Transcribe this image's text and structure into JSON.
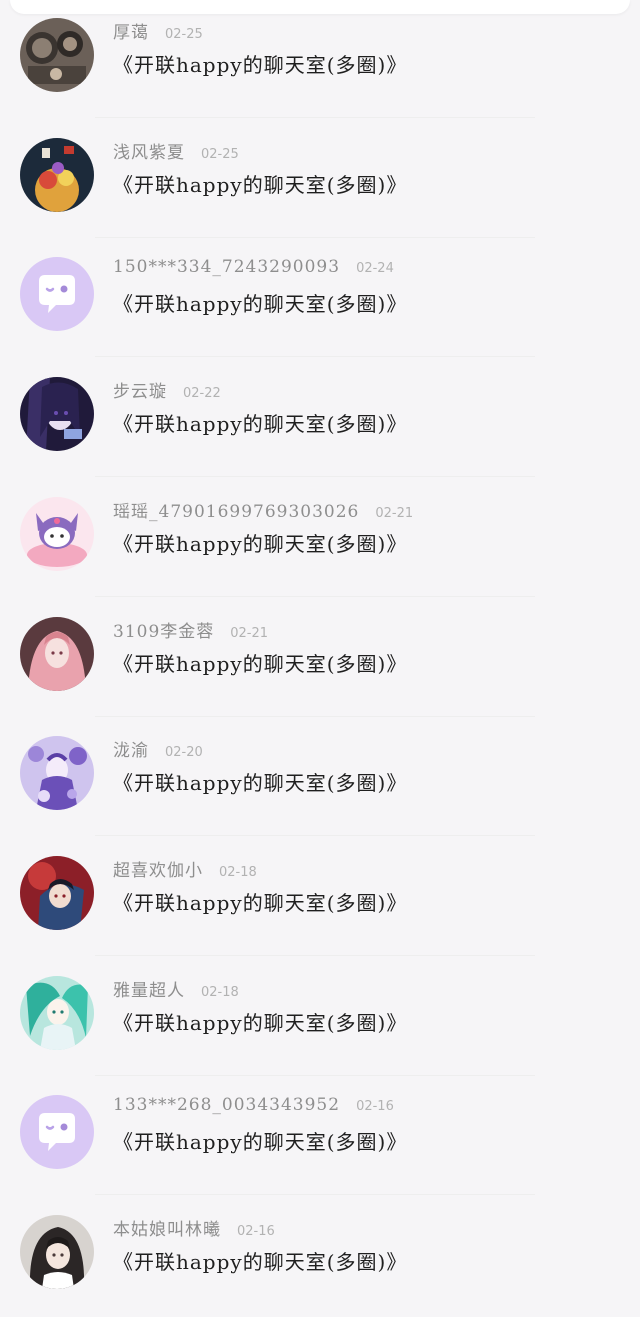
{
  "colors": {
    "background": "#f6f5f7",
    "name_text": "#8e8e8e",
    "date_text": "#b2b2b2",
    "message_text": "#1f1f1f",
    "default_avatar_bg": "#d9c8f5"
  },
  "comments": [
    {
      "name": "厚蔼",
      "date": "02-25",
      "message": "《开联happy的聊天室(多圈)》",
      "avatar": "dark-photo-avatar"
    },
    {
      "name": "浅风紫夏",
      "date": "02-25",
      "message": "《开联happy的聊天室(多圈)》",
      "avatar": "festive-illustration-avatar"
    },
    {
      "name": "150***334_7243290093",
      "date": "02-24",
      "message": "《开联happy的聊天室(多圈)》",
      "avatar": "default-chat-bubble-avatar"
    },
    {
      "name": "步云璇",
      "date": "02-22",
      "message": "《开联happy的聊天室(多圈)》",
      "avatar": "anime-girl-dark-avatar"
    },
    {
      "name": "瑶瑶_47901699769303026",
      "date": "02-21",
      "message": "《开联happy的聊天室(多圈)》",
      "avatar": "kuromi-pink-avatar"
    },
    {
      "name": "3109李金蓉",
      "date": "02-21",
      "message": "《开联happy的聊天室(多圈)》",
      "avatar": "anime-girl-pink-hair-avatar"
    },
    {
      "name": "泷渝",
      "date": "02-20",
      "message": "《开联happy的聊天室(多圈)》",
      "avatar": "anime-girl-purple-avatar"
    },
    {
      "name": "超喜欢伽小",
      "date": "02-18",
      "message": "《开联happy的聊天室(多圈)》",
      "avatar": "anime-boy-red-avatar"
    },
    {
      "name": "雅量超人",
      "date": "02-18",
      "message": "《开联happy的聊天室(多圈)》",
      "avatar": "anime-girl-teal-avatar"
    },
    {
      "name": "133***268_0034343952",
      "date": "02-16",
      "message": "《开联happy的聊天室(多圈)》",
      "avatar": "default-chat-bubble-avatar"
    },
    {
      "name": "本姑娘叫林曦",
      "date": "02-16",
      "message": "《开联happy的聊天室(多圈)》",
      "avatar": "anime-girl-dark-hair-avatar"
    }
  ]
}
